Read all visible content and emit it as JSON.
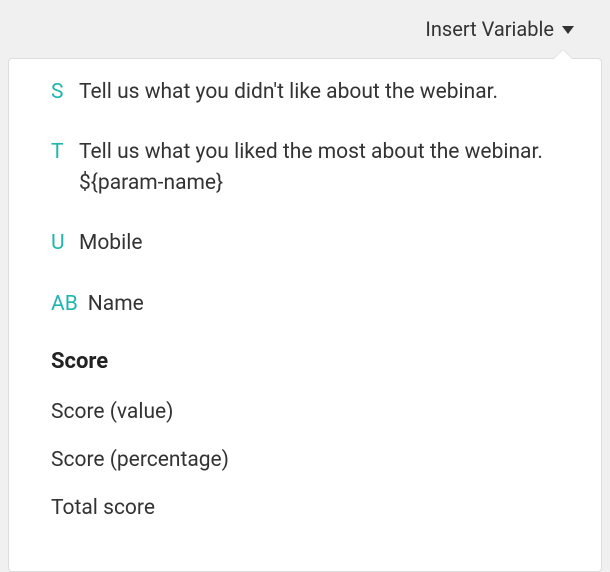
{
  "header": {
    "insert_variable_label": "Insert Variable"
  },
  "dropdown": {
    "variables": [
      {
        "letter": "S",
        "text": "Tell us what you didn't like about the webinar."
      },
      {
        "letter": "T",
        "text": "Tell us what you liked the most about the webinar. ${param-name}"
      },
      {
        "letter": "U",
        "text": "Mobile"
      },
      {
        "letter": "AB",
        "text": "Name"
      }
    ],
    "score_heading": "Score",
    "score_items": [
      {
        "label": "Score (value)"
      },
      {
        "label": "Score (percentage)"
      },
      {
        "label": "Total score"
      }
    ]
  }
}
